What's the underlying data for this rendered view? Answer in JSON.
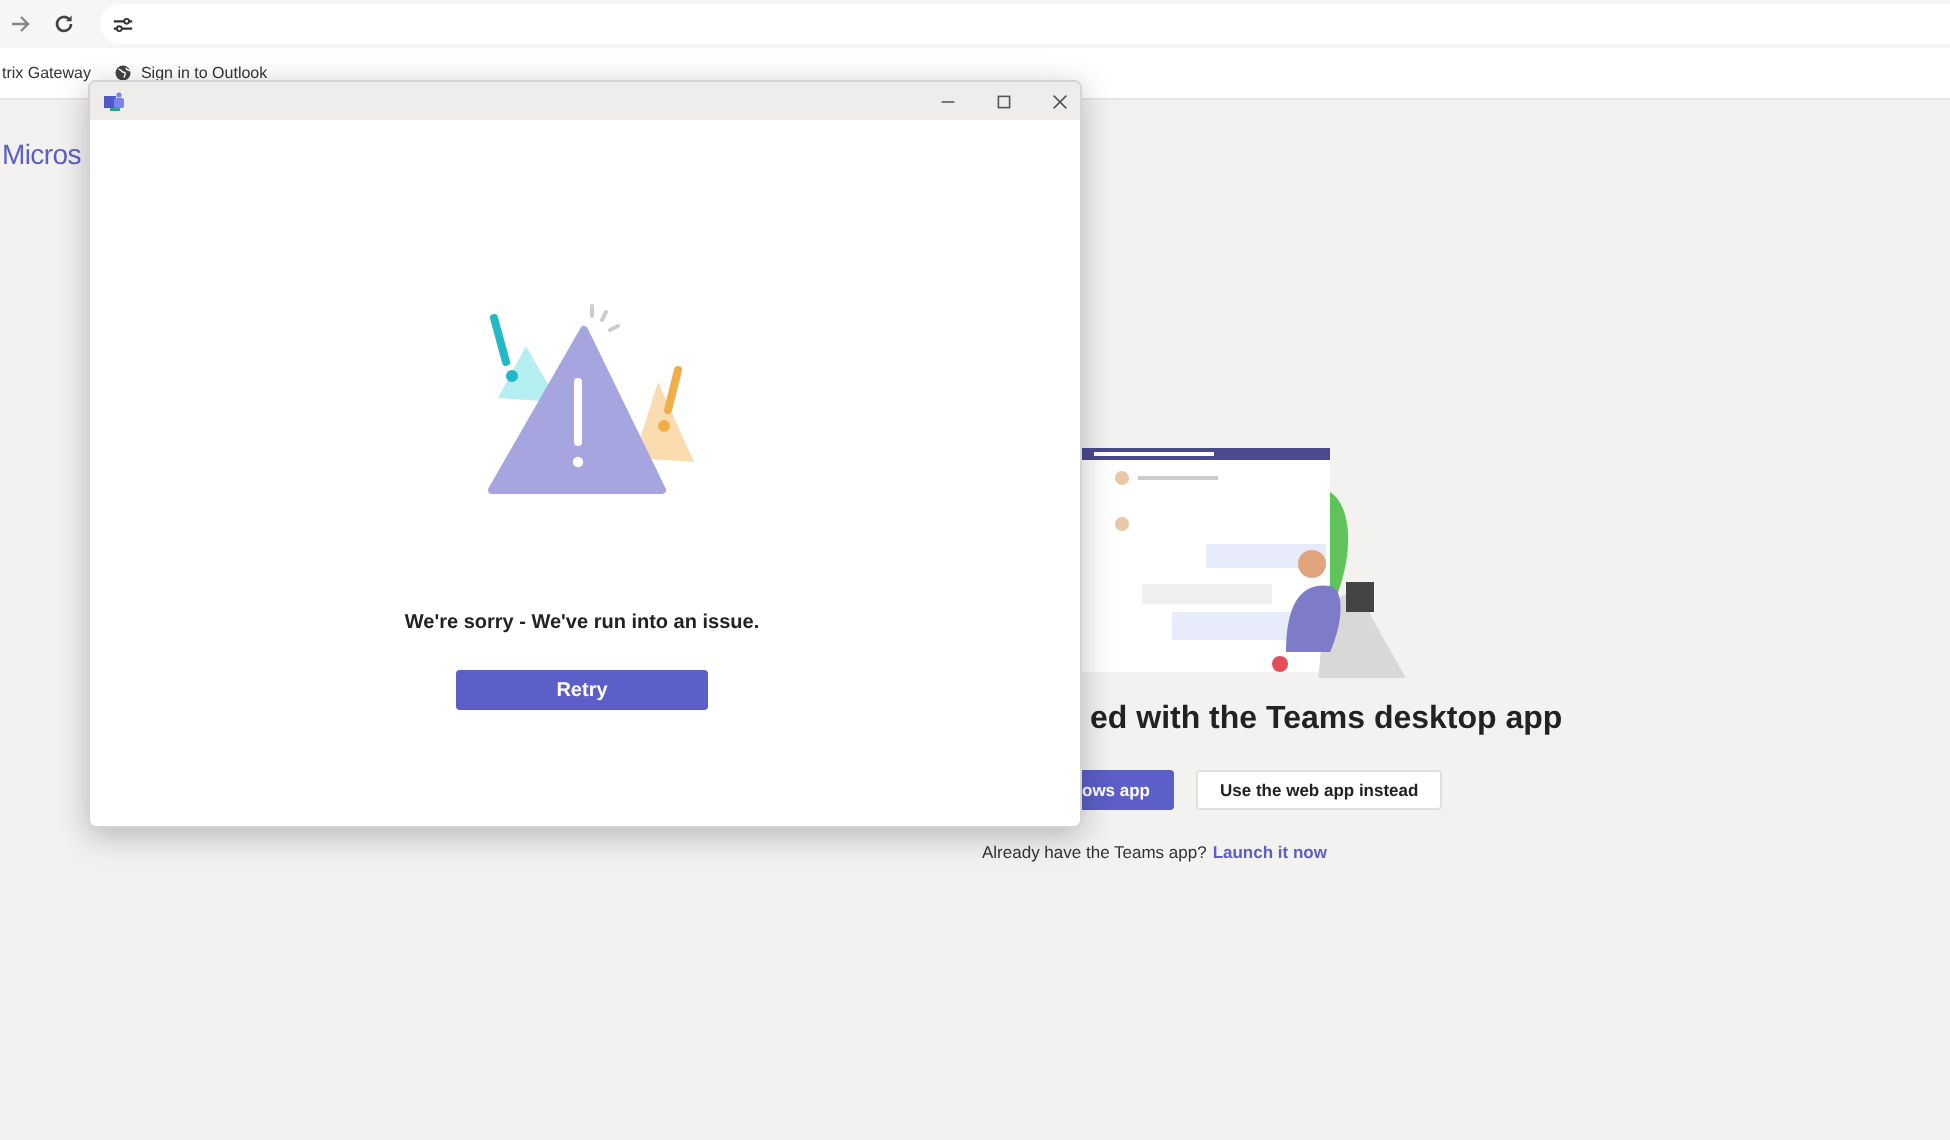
{
  "browser": {
    "bookmarks": [
      {
        "label": "trix Gateway",
        "kind": "plain"
      },
      {
        "label": "Sign in to Outlook",
        "kind": "globe"
      }
    ]
  },
  "page": {
    "brand": "Micros",
    "heading": "ed with the Teams desktop app",
    "buttons": [
      {
        "label": "ows app",
        "kind": "primary"
      },
      {
        "label": "Use the web app instead",
        "kind": "secondary"
      }
    ],
    "footer": {
      "text": "Already have the Teams app?",
      "link": "Launch it now"
    }
  },
  "dialog": {
    "message": "We're sorry - We've run into an issue.",
    "button": "Retry"
  }
}
